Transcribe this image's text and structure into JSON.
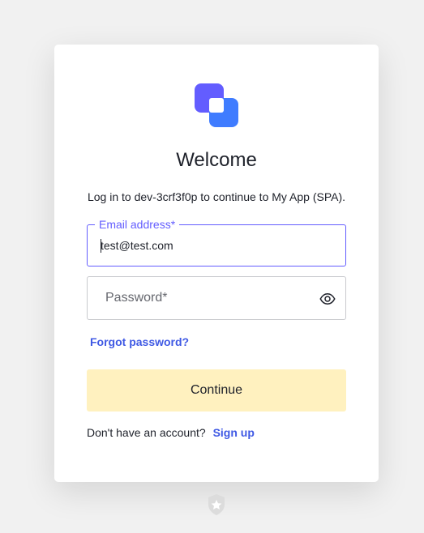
{
  "header": {
    "title": "Welcome",
    "subtitle": "Log in to dev-3crf3f0p to continue to My App (SPA)."
  },
  "form": {
    "email": {
      "label": "Email address*",
      "value": "test@test.com"
    },
    "password": {
      "placeholder": "Password*",
      "toggle_icon": "eye-icon"
    },
    "forgot_password_label": "Forgot password?",
    "continue_label": "Continue"
  },
  "footer": {
    "prompt": "Don't have an account?",
    "signup_label": "Sign up"
  },
  "colors": {
    "page_bg": "#f1f1f1",
    "accent": "#635dff",
    "link": "#3f59e4",
    "logo_back": "#635dff",
    "logo_front": "#3f7cff",
    "button_bg": "#fff1bf"
  },
  "icons": {
    "logo": "app-logo",
    "badge": "shield-star-icon"
  }
}
